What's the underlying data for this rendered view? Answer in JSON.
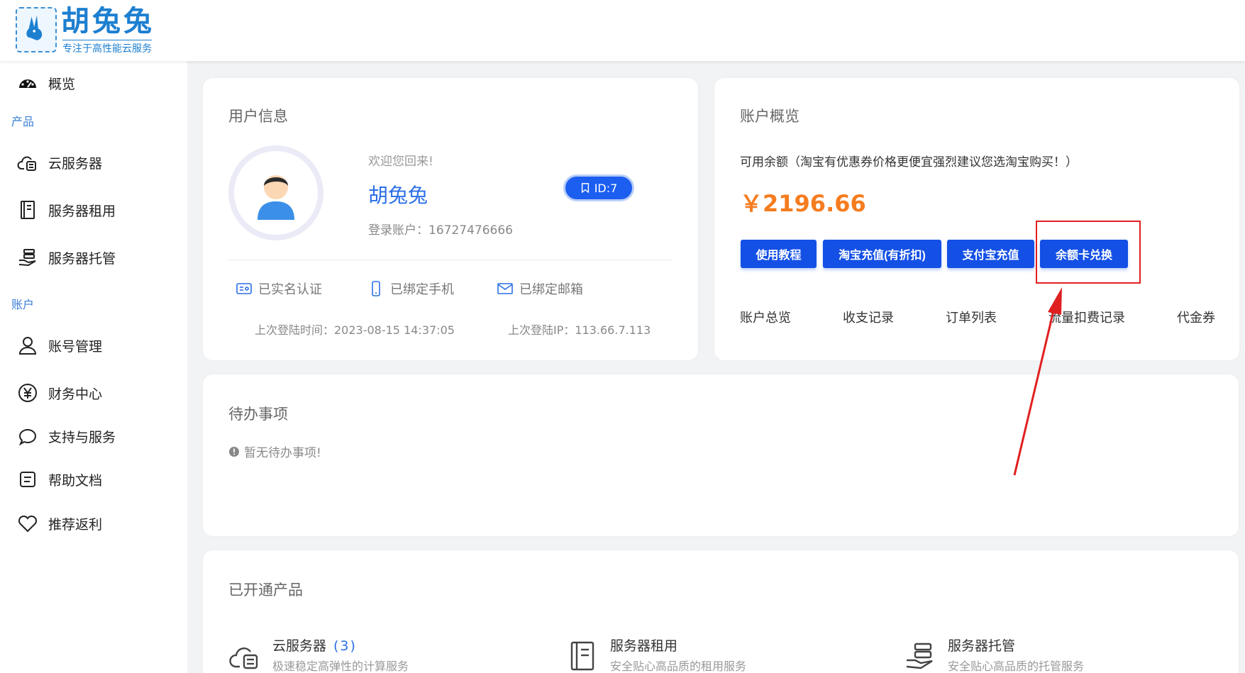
{
  "brand": {
    "title": "胡兔兔",
    "subtitle": "专注于高性能云服务"
  },
  "sidebar": {
    "overview": "概览",
    "section_products": "产品",
    "products": [
      "云服务器",
      "服务器租用",
      "服务器托管"
    ],
    "section_account": "账户",
    "account": [
      "账号管理",
      "财务中心",
      "支持与服务",
      "帮助文档",
      "推荐返利"
    ]
  },
  "user_card": {
    "title": "用户信息",
    "welcome": "欢迎您回来!",
    "username": "胡兔兔",
    "id_badge": "ID:7",
    "login_account": "登录账户：16727476666",
    "verifications": [
      "已实名认证",
      "已绑定手机",
      "已绑定邮箱"
    ],
    "last_login_time": "上次登陆时间：2023-08-15 14:37:05",
    "last_login_ip": "上次登陆IP：113.66.7.113"
  },
  "account_card": {
    "title": "账户概览",
    "balance_label": "可用余额（淘宝有优惠券价格更便宜强烈建议您选淘宝购买！）",
    "balance": "￥2196.66",
    "buttons": [
      "使用教程",
      "淘宝充值(有折扣)",
      "支付宝充值",
      "余额卡兑换"
    ],
    "tabs": [
      "账户总览",
      "收支记录",
      "订单列表",
      "流量扣费记录",
      "代金券"
    ]
  },
  "todo_card": {
    "title": "待办事项",
    "empty": "暂无待办事项!"
  },
  "products_card": {
    "title": "已开通产品",
    "items": [
      {
        "name": "云服务器",
        "count": "(3)",
        "desc": "极速稳定高弹性的计算服务"
      },
      {
        "name": "服务器租用",
        "count": "",
        "desc": "安全贴心高品质的租用服务"
      },
      {
        "name": "服务器托管",
        "count": "",
        "desc": "安全贴心高品质的托管服务"
      }
    ]
  },
  "colors": {
    "primary": "#1450e6",
    "balance": "#f57c1f",
    "annotation": "#e02020"
  }
}
